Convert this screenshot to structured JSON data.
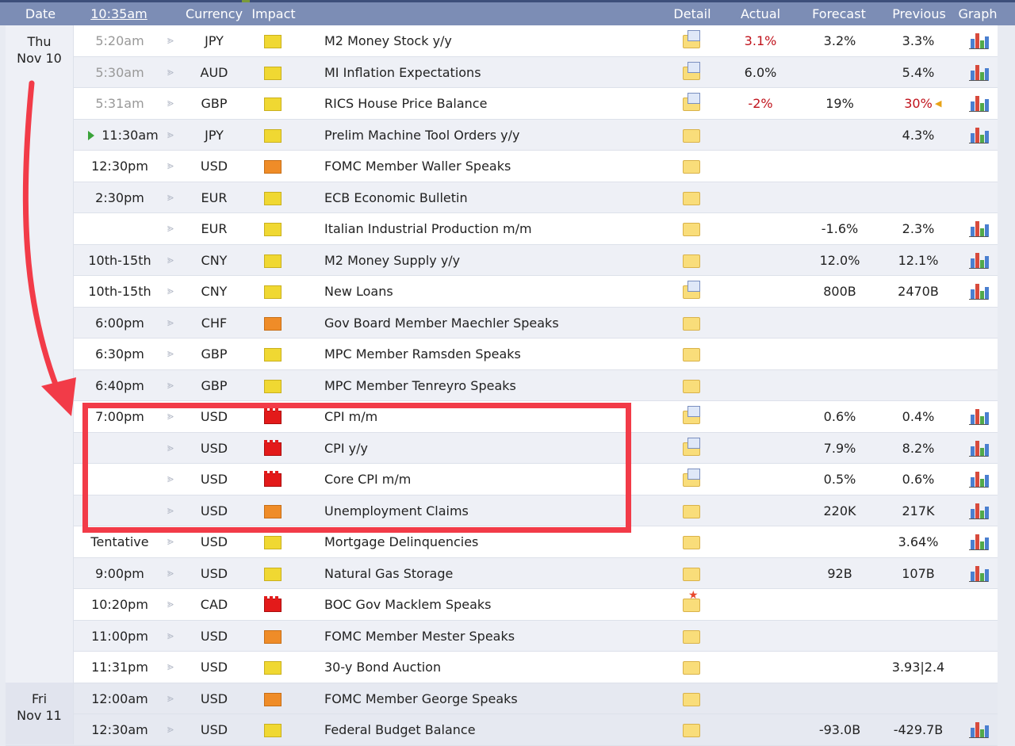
{
  "header": {
    "date": "Date",
    "time": "10:35am",
    "currency": "Currency",
    "impact": "Impact",
    "detail": "Detail",
    "actual": "Actual",
    "forecast": "Forecast",
    "previous": "Previous",
    "graph": "Graph"
  },
  "days": [
    {
      "weekday": "Thu",
      "date": "Nov 10"
    },
    {
      "weekday": "Fri",
      "date": "Nov 11"
    }
  ],
  "colors": {
    "header_bg": "#7c8db5",
    "highlight": "#f23b48",
    "impact_low": "#f0d832",
    "impact_medium": "#ef8c28",
    "impact_high": "#e31a1a",
    "negative": "#c0121b"
  },
  "rows": [
    {
      "time": "5:20am",
      "currency": "JPY",
      "impact": "yellow",
      "event": "M2 Money Stock y/y",
      "detail": "doc",
      "actual": "3.1%",
      "actual_red": true,
      "forecast": "3.2%",
      "previous": "3.3%",
      "previous_red": false,
      "graph": true,
      "past": true
    },
    {
      "time": "5:30am",
      "currency": "AUD",
      "impact": "yellow",
      "event": "MI Inflation Expectations",
      "detail": "doc",
      "actual": "6.0%",
      "actual_red": false,
      "forecast": "",
      "previous": "5.4%",
      "previous_red": false,
      "graph": true,
      "past": true
    },
    {
      "time": "5:31am",
      "currency": "GBP",
      "impact": "yellow",
      "event": "RICS House Price Balance",
      "detail": "doc",
      "actual": "-2%",
      "actual_red": true,
      "forecast": "19%",
      "previous": "30%",
      "previous_red": true,
      "revised": true,
      "graph": true,
      "past": true
    },
    {
      "time": "11:30am",
      "currency": "JPY",
      "impact": "yellow",
      "event": "Prelim Machine Tool Orders y/y",
      "detail": "folder",
      "actual": "",
      "forecast": "",
      "previous": "4.3%",
      "graph": true,
      "next": true
    },
    {
      "time": "12:30pm",
      "currency": "USD",
      "impact": "orange",
      "event": "FOMC Member Waller Speaks",
      "detail": "folder",
      "actual": "",
      "forecast": "",
      "previous": "",
      "graph": false
    },
    {
      "time": "2:30pm",
      "currency": "EUR",
      "impact": "yellow",
      "event": "ECB Economic Bulletin",
      "detail": "folder",
      "actual": "",
      "forecast": "",
      "previous": "",
      "graph": false
    },
    {
      "time": "",
      "currency": "EUR",
      "impact": "yellow",
      "event": "Italian Industrial Production m/m",
      "detail": "folder",
      "actual": "",
      "forecast": "-1.6%",
      "previous": "2.3%",
      "graph": true
    },
    {
      "time": "10th-15th",
      "currency": "CNY",
      "impact": "yellow",
      "event": "M2 Money Supply y/y",
      "detail": "folder",
      "actual": "",
      "forecast": "12.0%",
      "previous": "12.1%",
      "graph": true
    },
    {
      "time": "10th-15th",
      "currency": "CNY",
      "impact": "yellow",
      "event": "New Loans",
      "detail": "doc",
      "actual": "",
      "forecast": "800B",
      "previous": "2470B",
      "graph": true
    },
    {
      "time": "6:00pm",
      "currency": "CHF",
      "impact": "orange",
      "event": "Gov Board Member Maechler Speaks",
      "detail": "folder",
      "actual": "",
      "forecast": "",
      "previous": "",
      "graph": false
    },
    {
      "time": "6:30pm",
      "currency": "GBP",
      "impact": "yellow",
      "event": "MPC Member Ramsden Speaks",
      "detail": "folder",
      "actual": "",
      "forecast": "",
      "previous": "",
      "graph": false
    },
    {
      "time": "6:40pm",
      "currency": "GBP",
      "impact": "yellow",
      "event": "MPC Member Tenreyro Speaks",
      "detail": "folder",
      "actual": "",
      "forecast": "",
      "previous": "",
      "graph": false
    },
    {
      "time": "7:00pm",
      "currency": "USD",
      "impact": "red",
      "event": "CPI m/m",
      "detail": "doc",
      "actual": "",
      "forecast": "0.6%",
      "previous": "0.4%",
      "graph": true
    },
    {
      "time": "",
      "currency": "USD",
      "impact": "red",
      "event": "CPI y/y",
      "detail": "doc",
      "actual": "",
      "forecast": "7.9%",
      "previous": "8.2%",
      "graph": true
    },
    {
      "time": "",
      "currency": "USD",
      "impact": "red",
      "event": "Core CPI m/m",
      "detail": "doc",
      "actual": "",
      "forecast": "0.5%",
      "previous": "0.6%",
      "graph": true
    },
    {
      "time": "",
      "currency": "USD",
      "impact": "orange",
      "event": "Unemployment Claims",
      "detail": "folder",
      "actual": "",
      "forecast": "220K",
      "previous": "217K",
      "graph": true
    },
    {
      "time": "Tentative",
      "currency": "USD",
      "impact": "yellow",
      "event": "Mortgage Delinquencies",
      "detail": "folder",
      "actual": "",
      "forecast": "",
      "previous": "3.64%",
      "graph": true
    },
    {
      "time": "9:00pm",
      "currency": "USD",
      "impact": "yellow",
      "event": "Natural Gas Storage",
      "detail": "folder",
      "actual": "",
      "forecast": "92B",
      "previous": "107B",
      "graph": true
    },
    {
      "time": "10:20pm",
      "currency": "CAD",
      "impact": "red",
      "event": "BOC Gov Macklem Speaks",
      "detail": "star",
      "actual": "",
      "forecast": "",
      "previous": "",
      "graph": false
    },
    {
      "time": "11:00pm",
      "currency": "USD",
      "impact": "orange",
      "event": "FOMC Member Mester Speaks",
      "detail": "folder",
      "actual": "",
      "forecast": "",
      "previous": "",
      "graph": false
    },
    {
      "time": "11:31pm",
      "currency": "USD",
      "impact": "yellow",
      "event": "30-y Bond Auction",
      "detail": "folder",
      "actual": "",
      "forecast": "",
      "previous": "3.93|2.4",
      "graph": false
    },
    {
      "time": "12:00am",
      "currency": "USD",
      "impact": "orange",
      "event": "FOMC Member George Speaks",
      "detail": "folder",
      "actual": "",
      "forecast": "",
      "previous": "",
      "graph": false,
      "friday": true
    },
    {
      "time": "12:30am",
      "currency": "USD",
      "impact": "yellow",
      "event": "Federal Budget Balance",
      "detail": "folder",
      "actual": "",
      "forecast": "-93.0B",
      "previous": "-429.7B",
      "graph": true,
      "friday": true
    }
  ]
}
